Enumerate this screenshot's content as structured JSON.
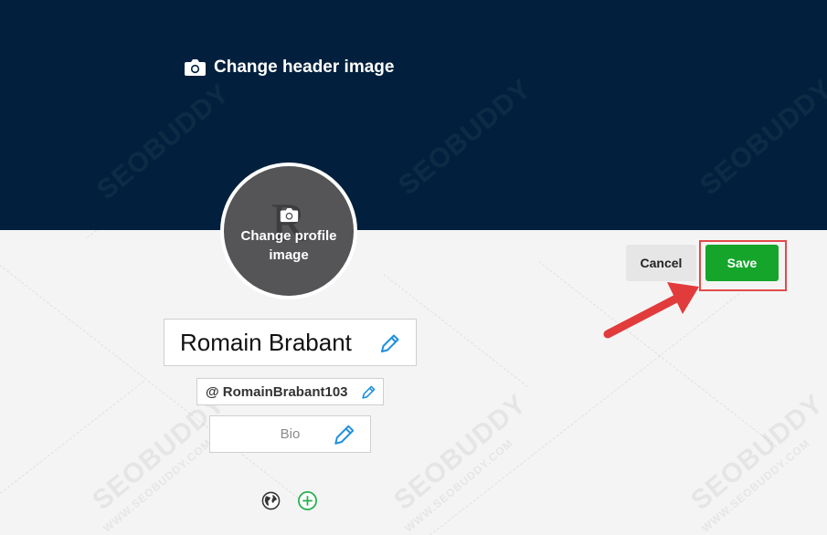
{
  "header": {
    "change_header_label": "Change header image",
    "icon": "camera-icon",
    "background_color": "#02203d"
  },
  "profile_image": {
    "letter": "R",
    "change_label": "Change profile image",
    "icon": "camera-icon"
  },
  "actions": {
    "cancel_label": "Cancel",
    "save_label": "Save",
    "save_color": "#15a52b",
    "highlight_color": "#e24a4a"
  },
  "profile": {
    "name": "Romain Brabant",
    "handle": "@ RomainBrabant103",
    "bio_placeholder": "Bio"
  },
  "links": {
    "icons": [
      "globe-icon",
      "plus-circle-icon"
    ]
  },
  "watermark": {
    "brand": "SEOBUDDY",
    "site": "WWW.SEOBUDDY.COM"
  }
}
